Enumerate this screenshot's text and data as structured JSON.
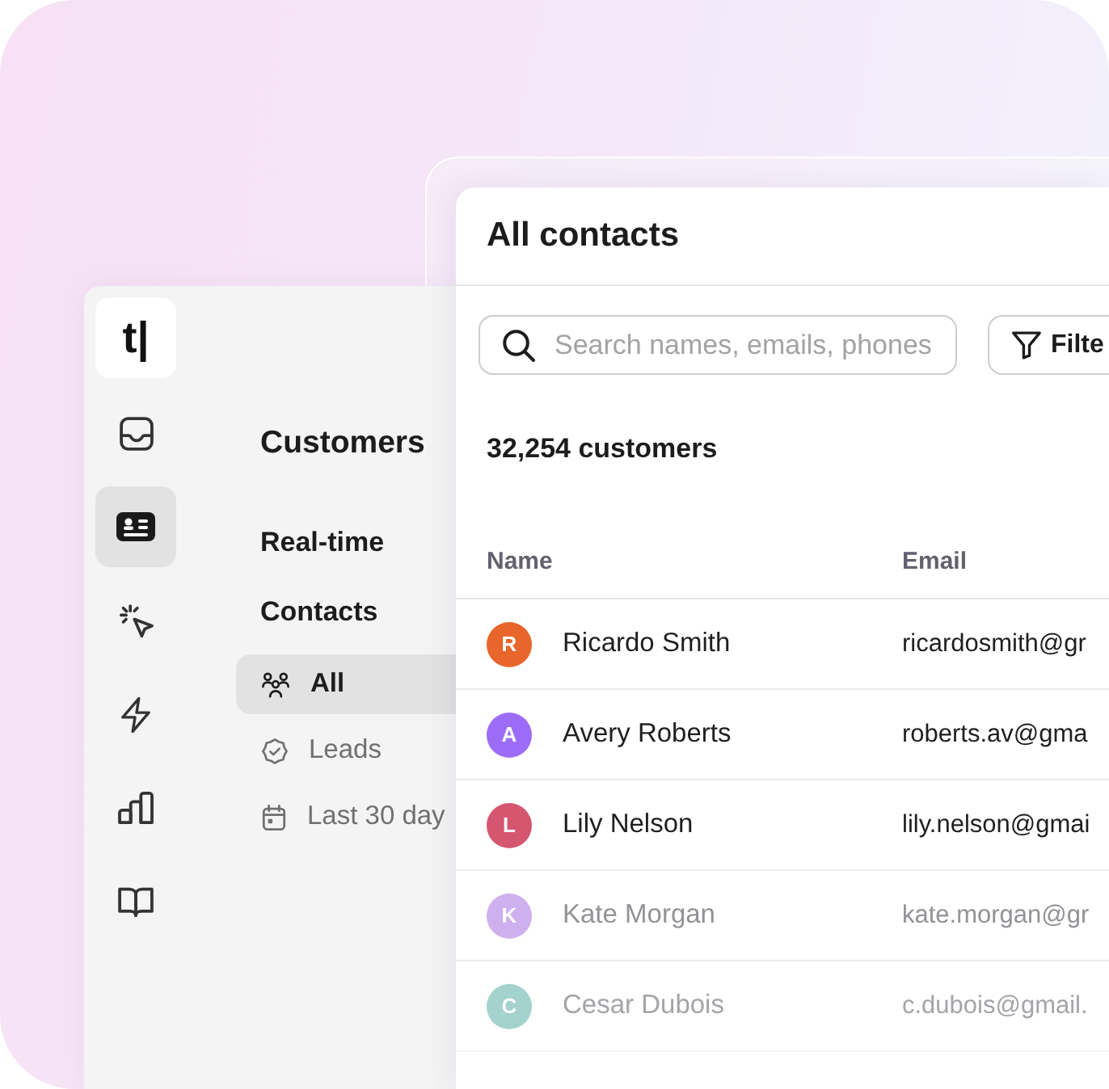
{
  "sidebar": {
    "logo": "t|",
    "rail": [
      {
        "kind": "inbox",
        "selected": false
      },
      {
        "kind": "contacts",
        "selected": true
      },
      {
        "kind": "click",
        "selected": false
      },
      {
        "kind": "bolt",
        "selected": false
      },
      {
        "kind": "chart",
        "selected": false
      },
      {
        "kind": "book",
        "selected": false
      }
    ],
    "title": "Customers",
    "sections": [
      {
        "label": "Real-time"
      },
      {
        "label": "Contacts",
        "items": [
          {
            "kind": "people",
            "label": "All",
            "selected": true
          },
          {
            "kind": "badge",
            "label": "Leads",
            "selected": false
          },
          {
            "kind": "calendar",
            "label": "Last 30 day",
            "selected": false
          }
        ]
      }
    ]
  },
  "contacts_panel": {
    "title": "All contacts",
    "search": {
      "placeholder": "Search names, emails, phones"
    },
    "filter_button": "Filte",
    "count": "32,254 customers",
    "table": {
      "columns": [
        "Name",
        "Email"
      ],
      "rows": [
        {
          "initial": "R",
          "name": "Ricardo Smith",
          "email": "ricardosmith@gr",
          "color": "#e8652b"
        },
        {
          "initial": "A",
          "name": "Avery Roberts",
          "email": "roberts.av@gma",
          "color": "#9d6cf6"
        },
        {
          "initial": "L",
          "name": "Lily Nelson",
          "email": "lily.nelson@gmai",
          "color": "#d5566f"
        },
        {
          "initial": "K",
          "name": "Kate Morgan",
          "email": "kate.morgan@gr",
          "color": "#cfb0ee"
        },
        {
          "initial": "C",
          "name": "Cesar Dubois",
          "email": "c.dubois@gmail.",
          "color": "#a3d3cc"
        }
      ]
    }
  }
}
